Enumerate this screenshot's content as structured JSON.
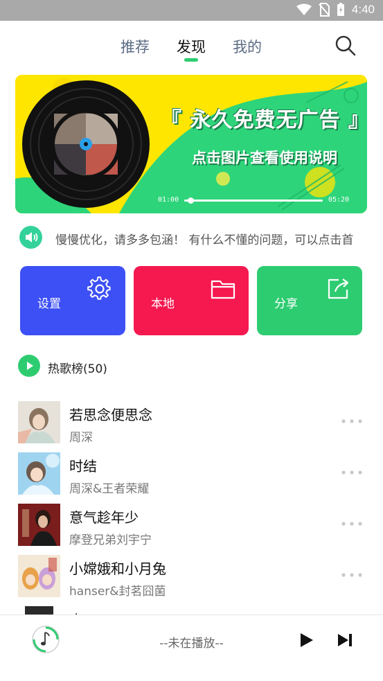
{
  "status_bar": {
    "time": "4:40",
    "icons": [
      "wifi-icon",
      "no-sim-icon",
      "battery-icon"
    ]
  },
  "tabs": [
    {
      "label": "推荐",
      "active": false
    },
    {
      "label": "发现",
      "active": true
    },
    {
      "label": "我的",
      "active": false
    }
  ],
  "search": {
    "icon": "search-icon"
  },
  "banner": {
    "title": "『 永久免费无广告 』",
    "subtitle": "点击图片查看使用说明",
    "time_start": "01:00",
    "time_end": "05:20",
    "colors": {
      "yellow": "#ffe600",
      "green": "#2ed47a"
    }
  },
  "notice": {
    "icon": "speaker-icon",
    "text": "慢慢优化，请多多包涵！ 有什么不懂的问题，可以点击首"
  },
  "quick_actions": [
    {
      "label": "设置",
      "icon": "gear-icon",
      "color": "#3d50f5"
    },
    {
      "label": "本地",
      "icon": "folder-icon",
      "color": "#f5194f"
    },
    {
      "label": "分享",
      "icon": "share-icon",
      "color": "#2ecc71"
    }
  ],
  "hot_list": {
    "title": "热歌榜(50)",
    "songs": [
      {
        "title": "若思念便思念",
        "artist": "周深"
      },
      {
        "title": "时结",
        "artist": "周深&王者荣耀"
      },
      {
        "title": "意气趁年少",
        "artist": "摩登兄弟刘宇宁"
      },
      {
        "title": "小嫦娥和小月兔",
        "artist": "hanser&封茗囧菌"
      },
      {
        "title": "小",
        "artist": ""
      }
    ]
  },
  "player": {
    "status": "--未在播放--",
    "accent": "#2ecc71"
  }
}
